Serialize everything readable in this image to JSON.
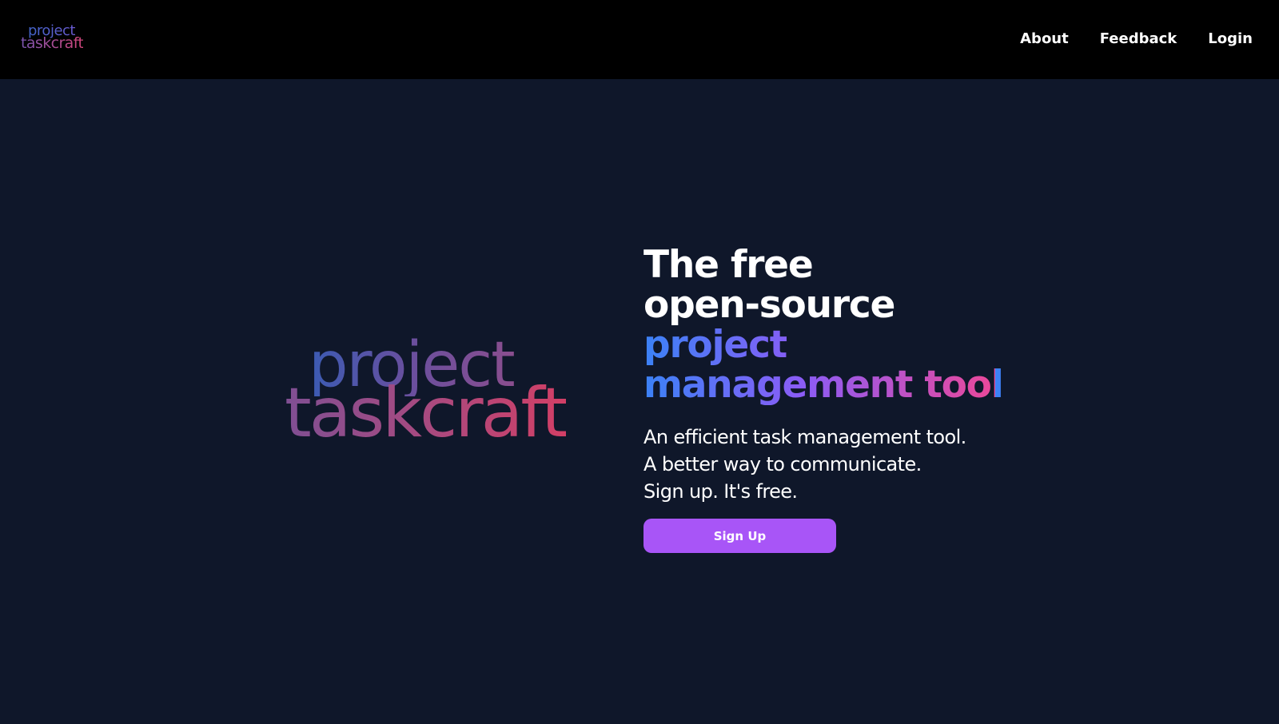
{
  "nav": {
    "logo_line1": "project",
    "logo_line2": "taskcraft",
    "links": [
      "About",
      "Feedback",
      "Login"
    ]
  },
  "hero": {
    "logo_line1": "project",
    "logo_line2": "taskcraft",
    "headline": {
      "line1": "The free",
      "line2": "open-source",
      "line3": "project",
      "line4": "management tool"
    },
    "taglines": [
      "An efficient task management tool.",
      "A better way to communicate.",
      "Sign up. It's free."
    ],
    "signup_label": "Sign Up"
  },
  "colors": {
    "page_bg": "#0f172a",
    "navbar_bg": "#000000",
    "accent_button": "#a855f7",
    "gradient_start": "#3b82f6",
    "gradient_mid": "#8b5cf6",
    "gradient_end": "#ec4899"
  }
}
